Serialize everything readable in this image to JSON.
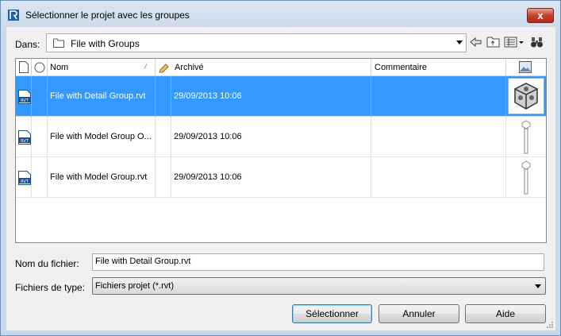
{
  "window": {
    "title": "Sélectionner le projet avec les groupes",
    "close_symbol": "x"
  },
  "location": {
    "label": "Dans:",
    "value": "File with Groups",
    "icon": "folder-icon"
  },
  "toolbar": {
    "icons": [
      "back-icon",
      "up-folder-icon",
      "views-icon",
      "views-dropdown-icon",
      "binoculars-icon"
    ]
  },
  "file_list": {
    "columns": {
      "name": "Nom",
      "archived": "Archivé",
      "comment": "Commentaire"
    },
    "rows": [
      {
        "name": "File with Detail Group.rvt",
        "archived": "29/09/2013 10:06",
        "comment": "",
        "selected": true,
        "thumbnail": "cube-thumbnail"
      },
      {
        "name": "File with Model Group O...",
        "archived": "29/09/2013 10:06",
        "comment": "",
        "selected": false,
        "thumbnail": "pole-thumbnail"
      },
      {
        "name": "File with Model Group.rvt",
        "archived": "29/09/2013 10:06",
        "comment": "",
        "selected": false,
        "thumbnail": "pole-thumbnail"
      }
    ],
    "file_icon_text": "RVT"
  },
  "filename": {
    "label": "Nom du fichier:",
    "value": "File with Detail Group.rvt"
  },
  "filetype": {
    "label": "Fichiers de type:",
    "value": "Fichiers projet (*.rvt)"
  },
  "buttons": {
    "select": "Sélectionner",
    "cancel": "Annuler",
    "help": "Aide"
  },
  "colors": {
    "selection": "#3399ff",
    "close_button": "#c4412c"
  }
}
